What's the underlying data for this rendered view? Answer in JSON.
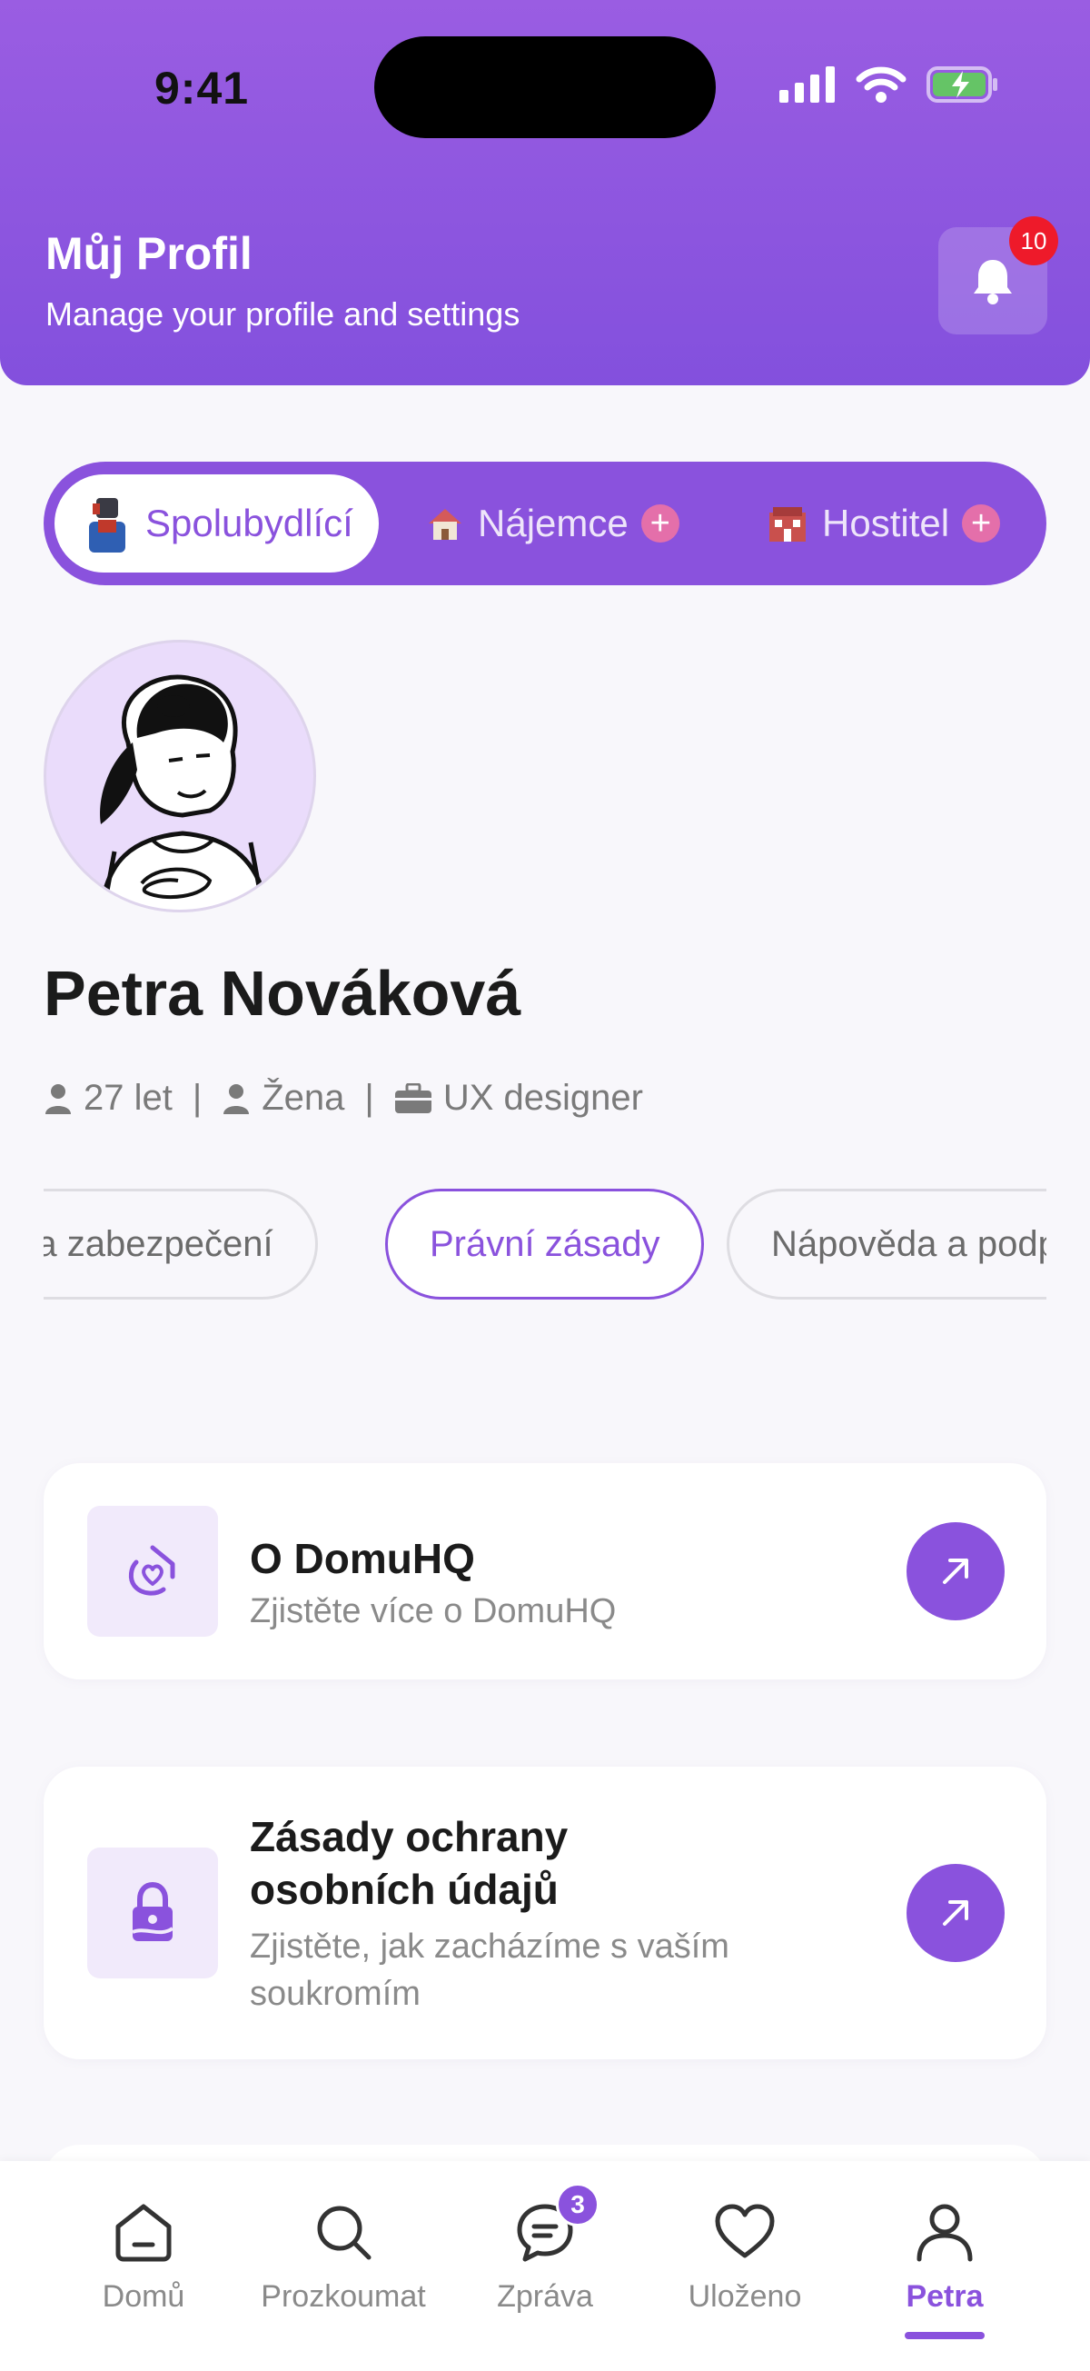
{
  "status_bar": {
    "time": "9:41"
  },
  "header": {
    "title": "Můj Profil",
    "subtitle": "Manage your profile and settings",
    "notification_count": "10"
  },
  "roles": [
    {
      "label": "Spolubydlící",
      "icon": "roommate-emoji",
      "active": true
    },
    {
      "label": "Nájemce",
      "icon": "house-emoji",
      "active": false
    },
    {
      "label": "Hostitel",
      "icon": "building-emoji",
      "active": false
    }
  ],
  "profile": {
    "name": "Petra Nováková",
    "age": "27 let",
    "gender": "Žena",
    "job": "UX designer"
  },
  "chips": [
    "a a zabezpečení",
    "Právní zásady",
    "Nápověda a podpora"
  ],
  "cards": [
    {
      "title": "O DomuHQ",
      "subtitle": "Zjistěte více o DomuHQ",
      "icon": "domuhq-logo-icon"
    },
    {
      "title": "Zásady ochrany osobních údajů",
      "subtitle": "Zjistěte, jak zacházíme s vaším soukromím",
      "icon": "privacy-lock-icon"
    }
  ],
  "tabs": [
    {
      "label": "Domů",
      "icon": "home-icon"
    },
    {
      "label": "Prozkoumat",
      "icon": "search-icon"
    },
    {
      "label": "Zpráva",
      "icon": "chat-icon",
      "badge": "3"
    },
    {
      "label": "Uloženo",
      "icon": "heart-icon"
    },
    {
      "label": "Petra",
      "icon": "user-icon",
      "active": true
    }
  ],
  "colors": {
    "accent": "#8A52DD",
    "badge_red": "#EE1A2A",
    "role_plus": "#E46FAA"
  }
}
